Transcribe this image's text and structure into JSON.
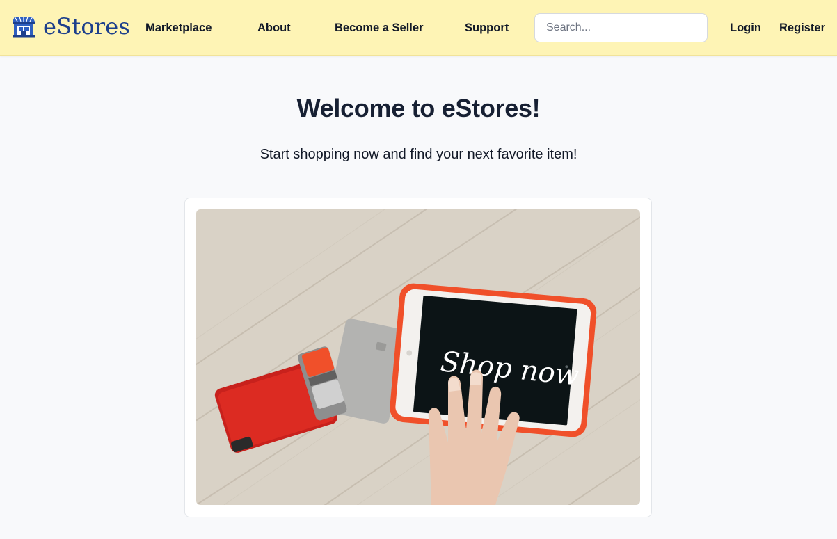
{
  "brand": {
    "name": "eStores",
    "logo_icon": "storefront-icon",
    "color": "#1d3f8c"
  },
  "nav": {
    "marketplace": "Marketplace",
    "about": "About",
    "become_seller": "Become a Seller",
    "support": "Support"
  },
  "search": {
    "placeholder": "Search...",
    "value": ""
  },
  "auth": {
    "login": "Login",
    "register": "Register"
  },
  "hero": {
    "title": "Welcome to eStores!",
    "subtitle": "Start shopping now and find your next favorite item!",
    "image_text": "Shop now"
  },
  "colors": {
    "navbar_bg": "#fef4b5",
    "page_bg": "#f8f9fb",
    "tablet_case": "#f0502a",
    "wallet": "#d8271f"
  }
}
